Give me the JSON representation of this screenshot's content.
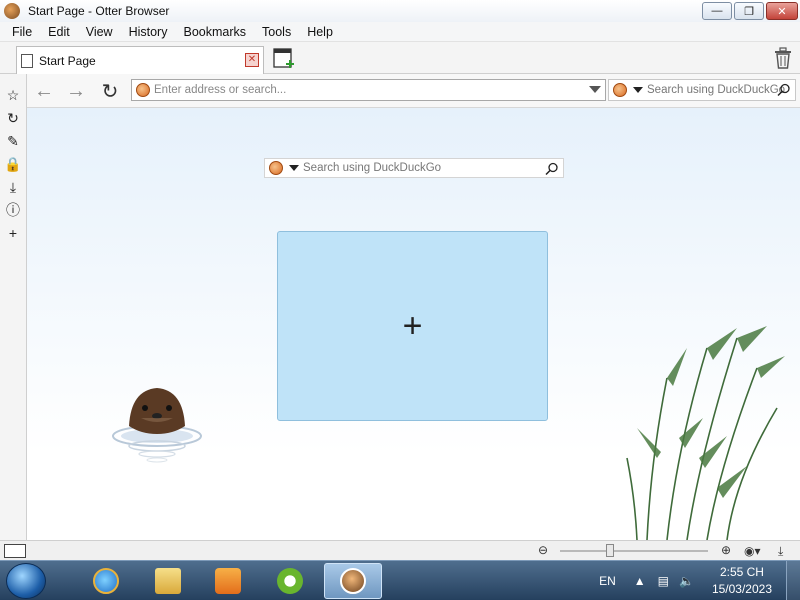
{
  "window": {
    "title": "Start Page - Otter Browser"
  },
  "menu": [
    "File",
    "Edit",
    "View",
    "History",
    "Bookmarks",
    "Tools",
    "Help"
  ],
  "tabs": [
    {
      "label": "Start Page"
    }
  ],
  "address": {
    "placeholder": "Enter address or search..."
  },
  "search": {
    "placeholder": "Search using DuckDuckGo"
  },
  "start_page": {
    "search_placeholder": "Search using DuckDuckGo",
    "add_tile_symbol": "+"
  },
  "taskbar": {
    "language": "EN",
    "time": "2:55 CH",
    "date": "15/03/2023"
  },
  "colors": {
    "tile": "#bfe3f8",
    "content_top": "#e6f1fb",
    "taskbar": "#2d4b6b"
  }
}
